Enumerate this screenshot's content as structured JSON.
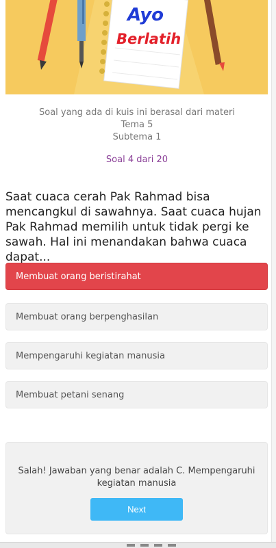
{
  "banner": {
    "title_line1": "Ayo",
    "title_line2": "Berlatih",
    "colors": {
      "background": "#f6ca5e",
      "title1": "#1f3bd6",
      "title2": "#e3202a"
    }
  },
  "intro": {
    "line1": "Soal yang ada di kuis ini berasal dari materi",
    "line2": "Tema 5",
    "line3": "Subtema 1"
  },
  "counter": "Soal 4 dari 20",
  "question": "Saat cuaca cerah Pak Rahmad bisa mencangkul di sawahnya. Saat cuaca hujan Pak Rahmad memilih untuk tidak pergi ke sawah. Hal ini menandakan bahwa cuaca dapat...",
  "options": [
    {
      "label": "Membuat orang beristirahat",
      "state": "wrong-selected"
    },
    {
      "label": "Membuat orang berpenghasilan",
      "state": "default"
    },
    {
      "label": "Mempengaruhi kegiatan manusia",
      "state": "default"
    },
    {
      "label": "Membuat petani senang",
      "state": "default"
    }
  ],
  "feedback": {
    "message": "Salah! Jawaban yang benar adalah C. Mempengaruhi kegiatan manusia",
    "next_label": "Next"
  },
  "colors": {
    "wrong": "#e2454b",
    "accent_button": "#3fb8f6",
    "counter": "#8a3f97"
  },
  "icons": [
    "pencil-icon",
    "pen-icon",
    "notebook-icon"
  ]
}
